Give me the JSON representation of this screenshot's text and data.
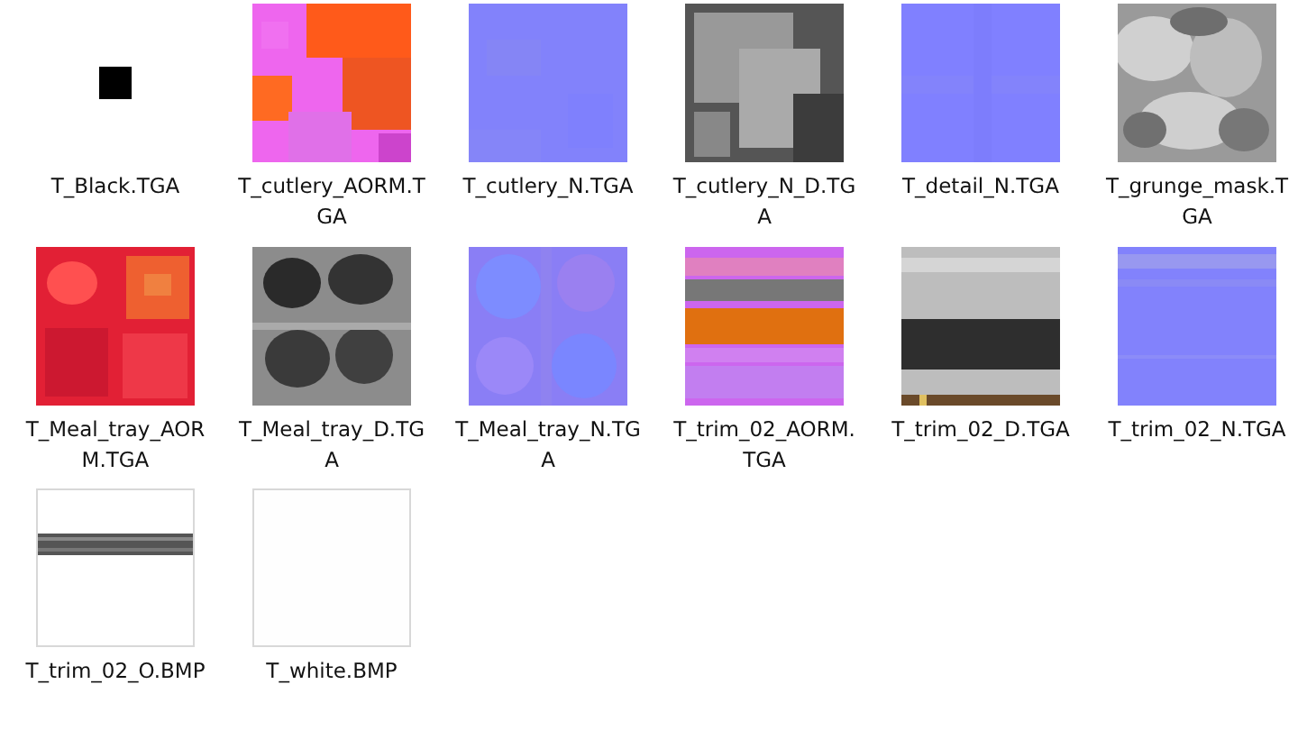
{
  "files": [
    {
      "name": "T_Black.TGA"
    },
    {
      "name": "T_cutlery_AORM.TGA"
    },
    {
      "name": "T_cutlery_N.TGA"
    },
    {
      "name": "T_cutlery_N_D.TGA"
    },
    {
      "name": "T_detail_N.TGA"
    },
    {
      "name": "T_grunge_mask.TGA"
    },
    {
      "name": "T_Meal_tray_AORM.TGA"
    },
    {
      "name": "T_Meal_tray_D.TGA"
    },
    {
      "name": "T_Meal_tray_N.TGA"
    },
    {
      "name": "T_trim_02_AORM.TGA"
    },
    {
      "name": "T_trim_02_D.TGA"
    },
    {
      "name": "T_trim_02_N.TGA"
    },
    {
      "name": "T_trim_02_O.BMP"
    },
    {
      "name": "T_white.BMP"
    }
  ]
}
